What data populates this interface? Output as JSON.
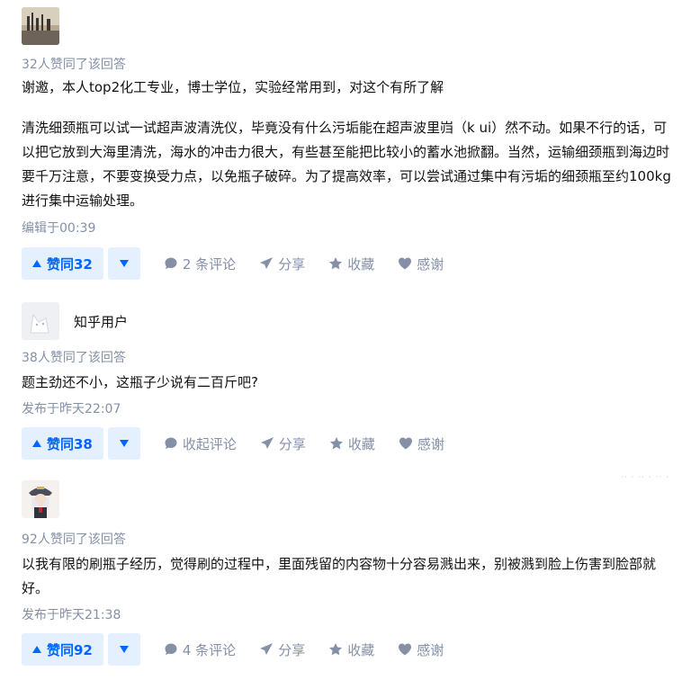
{
  "answers": [
    {
      "votes_note": "32人赞同了该回答",
      "paragraphs": [
        "谢邀，本人top2化工专业，博士学位，实验经常用到，对这个有所了解",
        "清洗细颈瓶可以试一试超声波清洗仪，毕竟没有什么污垢能在超声波里岿（k ui）然不动。如果不行的话，可以把它放到大海里清洗，海水的冲击力很大，有些甚至能把比较小的蓄水池掀翻。当然，运输细颈瓶到海边时要千万注意，不要变换受力点，以免瓶子破碎。为了提高效率，可以尝试通过集中有污垢的细颈瓶至约100kg进行集中运输处理。"
      ],
      "time": "编辑于00:39",
      "vote_label": "赞同32",
      "comment_label": "2 条评论",
      "share_label": "分享",
      "collect_label": "收藏",
      "thanks_label": "感谢"
    },
    {
      "author": "知乎用户",
      "votes_note": "38人赞同了该回答",
      "paragraphs": [
        "题主劲还不小，这瓶子少说有二百斤吧?"
      ],
      "time": "发布于昨天22:07",
      "vote_label": "赞同38",
      "comment_label": "收起评论",
      "share_label": "分享",
      "collect_label": "收藏",
      "thanks_label": "感谢"
    },
    {
      "votes_note": "92人赞同了该回答",
      "paragraphs": [
        "以我有限的刷瓶子经历，觉得刷的过程中，里面残留的内容物十分容易溅出来，别被溅到脸上伤害到脸部就好。"
      ],
      "time": "发布于昨天21:38",
      "vote_label": "赞同92",
      "comment_label": "4 条评论",
      "share_label": "分享",
      "collect_label": "收藏",
      "thanks_label": "感谢"
    }
  ],
  "watermark": "·· ·  ·· · ·· ·",
  "colors": {
    "accent": "#0066ff",
    "vote_bg": "#e5f0ff",
    "meta": "#8590a6"
  }
}
